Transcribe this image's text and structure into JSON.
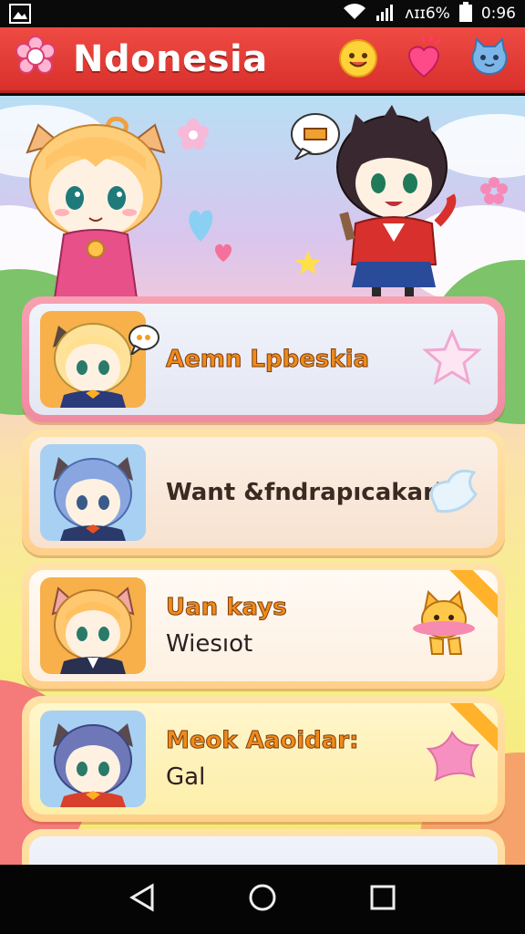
{
  "status_bar": {
    "battery_text": "ʌɪɪ6%",
    "time": "0:96"
  },
  "app_bar": {
    "title": "Ndonesia"
  },
  "list": [
    {
      "title": "Aemn Lpbeskia",
      "subtitle": ""
    },
    {
      "title": "Want &fndrapıcakarl",
      "subtitle": ""
    },
    {
      "title": "Uan kays",
      "subtitle": "Wiesıot"
    },
    {
      "title": "Meok Aaoidar:",
      "subtitle": "Gal"
    }
  ],
  "colors": {
    "app_bar": "#e2403a",
    "card_border": "#ffcf8a",
    "title_amber": "#f08a1a"
  },
  "icons": {
    "app_logo": "flower-gear-icon",
    "actions": [
      "smiley-icon",
      "heart-bomb-icon",
      "blue-cat-icon"
    ],
    "nav": [
      "back-icon",
      "home-icon",
      "recents-icon"
    ]
  }
}
